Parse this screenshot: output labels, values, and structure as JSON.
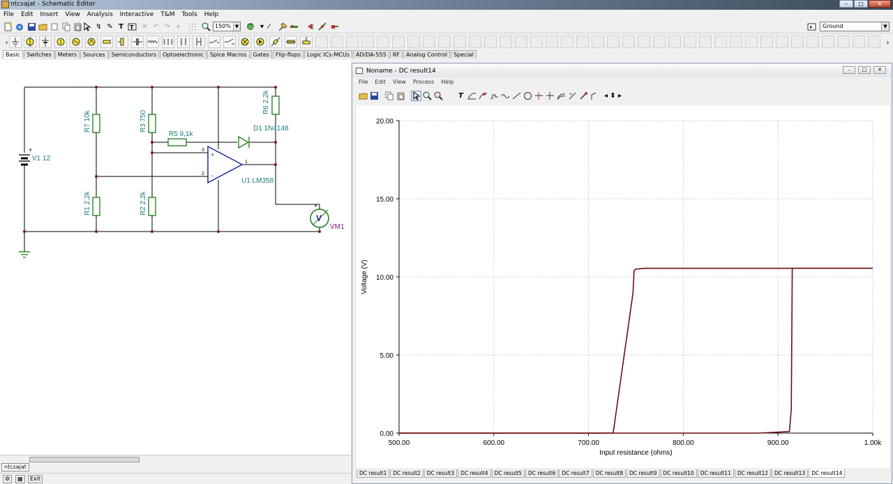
{
  "window": {
    "title": "ntcsajat - Schematic Editor",
    "controls": {
      "minimize": "–",
      "maximize": "□",
      "close": "✕"
    }
  },
  "menu": [
    "File",
    "Edit",
    "Insert",
    "View",
    "Analysis",
    "Interactive",
    "T&M",
    "Tools",
    "Help"
  ],
  "toolbar": {
    "zoom": "150%",
    "ground_select": "Ground"
  },
  "component_tabs": [
    "Basic",
    "Switches",
    "Meters",
    "Sources",
    "Semiconductors",
    "Optoelectronic",
    "Spice Macros",
    "Gates",
    "Flip-flops",
    "Logic ICs-MCUs",
    "AD/DA-555",
    "RF",
    "Analog Control",
    "Special"
  ],
  "schematic": {
    "labels": {
      "r7": "R7 10k",
      "r3": "R3 750",
      "r6": "R6 2,2k",
      "r5": "R5 9,1k",
      "d1": "D1 1N4148",
      "v1": "V1 12",
      "u1": "U1 LM358",
      "r1": "R1 2,2k",
      "r2": "R2 2,2k",
      "vm1": "VM1",
      "vm1_symbol": "V",
      "pin3": "3",
      "pin2": "2",
      "pin1": "1",
      "plus": "+",
      "minus": "-"
    }
  },
  "doc_tab": "ntcsajat",
  "status": {
    "exit": "Exit"
  },
  "result_window": {
    "title": "Noname - DC result14",
    "menu": [
      "File",
      "Edit",
      "View",
      "Process",
      "Help"
    ],
    "tabs": [
      "DC result1",
      "DC result2",
      "DC result3",
      "DC result4",
      "DC result5",
      "DC result6",
      "DC result7",
      "DC result8",
      "DC result9",
      "DC result10",
      "DC result11",
      "DC result12",
      "DC result13",
      "DC result14"
    ],
    "active_tab": "DC result14"
  },
  "chart_data": {
    "type": "line",
    "xlabel": "Input resistance (ohms)",
    "ylabel": "Voltage (V)",
    "xlim": [
      500,
      1000
    ],
    "ylim": [
      0,
      20
    ],
    "x_ticks": [
      500,
      600,
      700,
      800,
      900,
      1000
    ],
    "x_tick_labels": [
      "500.00",
      "600.00",
      "700.00",
      "800.00",
      "900.00",
      "1.00k"
    ],
    "y_ticks": [
      0,
      5,
      10,
      15,
      20
    ],
    "y_tick_labels": [
      "0.00",
      "5.00",
      "10.00",
      "15.00",
      "20.00"
    ],
    "grid": true,
    "line_color": "#6b0f0f",
    "series": [
      {
        "x": [
          500,
          726,
          747,
          748,
          750,
          760,
          1000
        ],
        "y": [
          0,
          0,
          9.0,
          10.4,
          10.5,
          10.55,
          10.55
        ]
      },
      {
        "x": [
          500,
          880,
          912,
          914,
          915,
          1000
        ],
        "y": [
          0,
          0,
          0.1,
          1.5,
          10.55,
          10.55
        ]
      }
    ]
  }
}
